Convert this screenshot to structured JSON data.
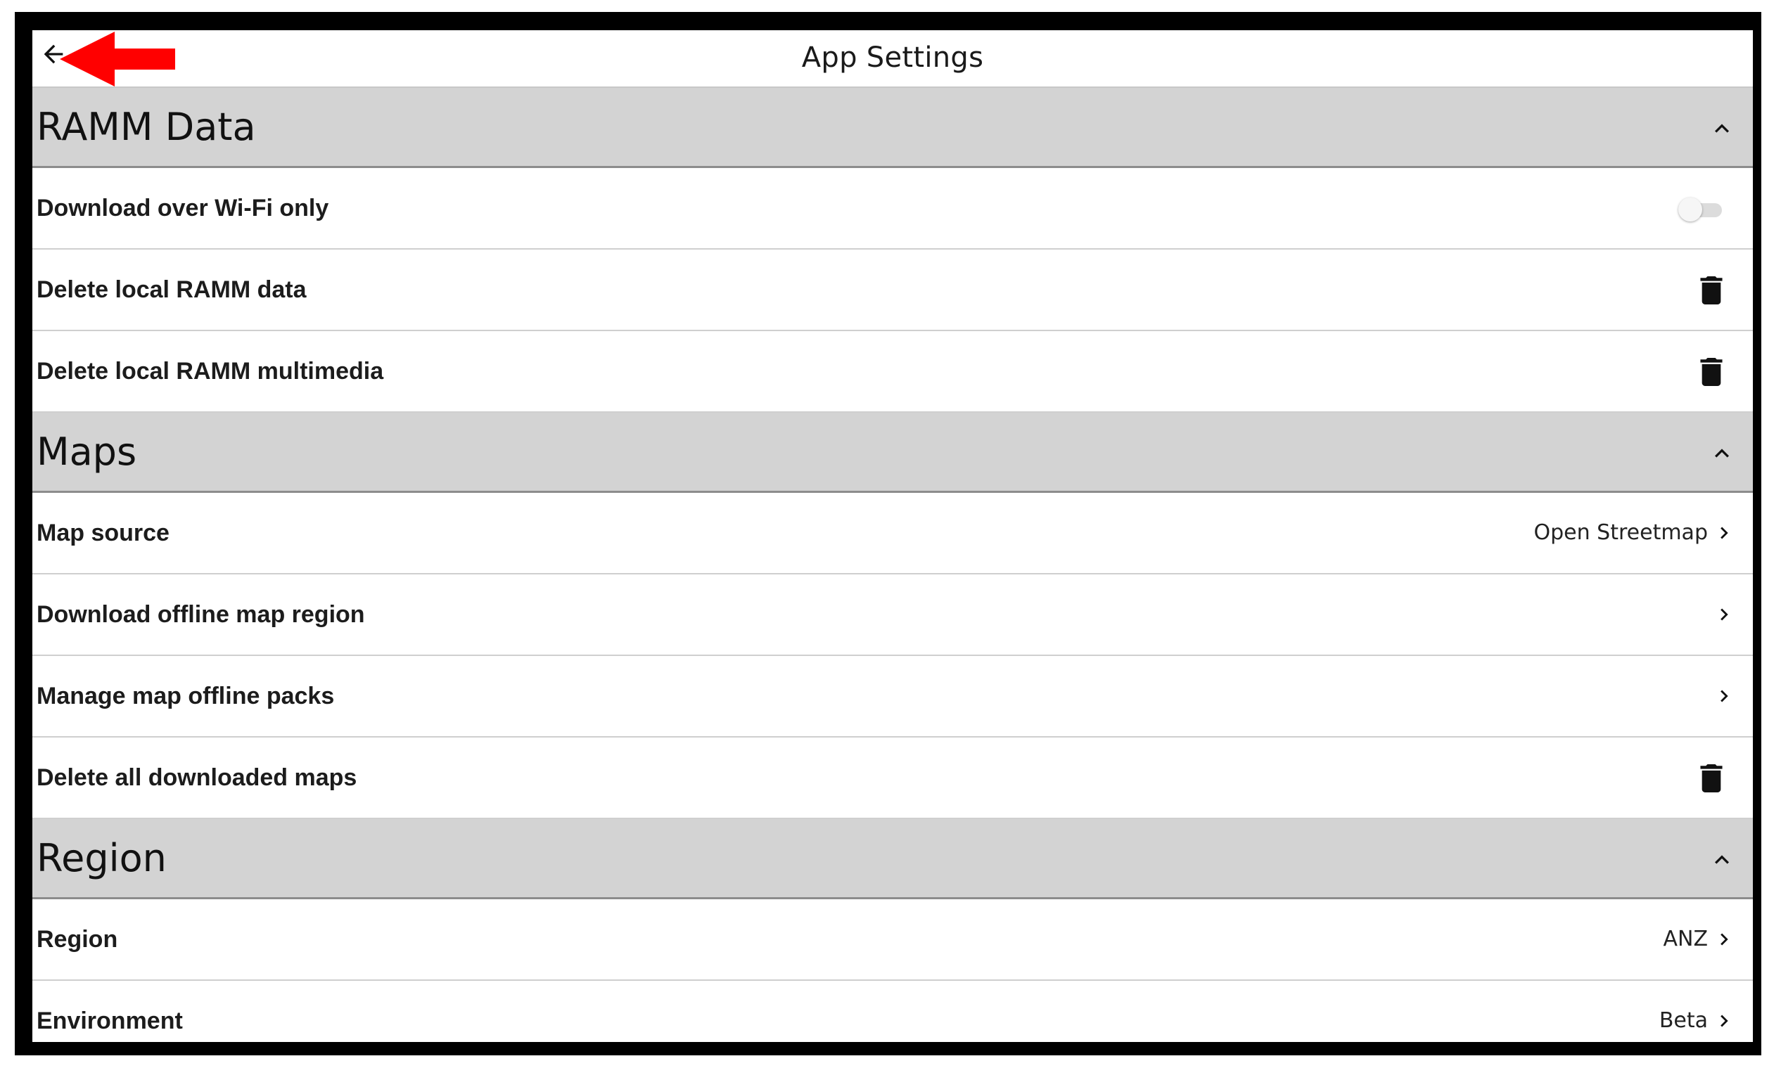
{
  "header": {
    "title": "App Settings",
    "back_icon": "arrow-left-icon",
    "annotation_icon": "red-arrow-pointer-icon"
  },
  "sections": [
    {
      "title": "RAMM Data",
      "expanded": true,
      "items": [
        {
          "label": "Download over Wi-Fi only",
          "control": "toggle",
          "toggle_on": false
        },
        {
          "label": "Delete local RAMM data",
          "control": "trash-icon"
        },
        {
          "label": "Delete local RAMM multimedia",
          "control": "trash-icon"
        }
      ]
    },
    {
      "title": "Maps",
      "expanded": true,
      "items": [
        {
          "label": "Map source",
          "value": "Open Streetmap",
          "control": "chevron-right-icon"
        },
        {
          "label": "Download offline map region",
          "control": "chevron-right-icon"
        },
        {
          "label": "Manage map offline packs",
          "control": "chevron-right-icon"
        },
        {
          "label": "Delete all downloaded maps",
          "control": "trash-icon"
        }
      ]
    },
    {
      "title": "Region",
      "expanded": true,
      "items": [
        {
          "label": "Region",
          "value": "ANZ",
          "control": "chevron-right-icon"
        },
        {
          "label": "Environment",
          "value": "Beta",
          "control": "chevron-right-icon"
        }
      ]
    }
  ],
  "colors": {
    "frame": "#000000",
    "section_bg": "#d3d3d3",
    "annotation_red": "#ff0000"
  }
}
